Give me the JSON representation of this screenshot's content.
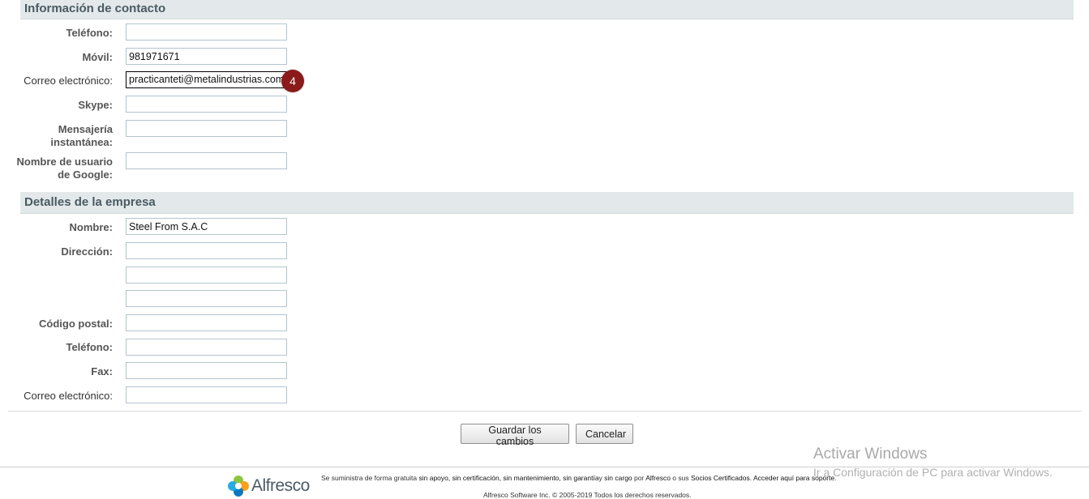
{
  "contact": {
    "title": "Información de contacto",
    "phone_label": "Teléfono:",
    "phone_value": "",
    "mobile_label": "Móvil:",
    "mobile_value": "981971671",
    "email_label": "Correo electrónico:",
    "email_value": "practicanteti@metalindustrias.com",
    "skype_label": "Skype:",
    "skype_value": "",
    "im_label_1": "Mensajería",
    "im_label_2": "instantánea:",
    "im_value": "",
    "google_label_1": "Nombre de usuario",
    "google_label_2": "de Google:",
    "google_value": ""
  },
  "badge": {
    "number": "4",
    "color": "#8b1a1a"
  },
  "company": {
    "title": "Detalles de la empresa",
    "name_label": "Nombre:",
    "name_value": "Steel From S.A.C",
    "address_label": "Dirección:",
    "address_1": "",
    "address_2": "",
    "address_3": "",
    "postal_label": "Código postal:",
    "postal_value": "",
    "phone_label": "Teléfono:",
    "phone_value": "",
    "fax_label": "Fax:",
    "fax_value": "",
    "email_label": "Correo electrónico:",
    "email_value": ""
  },
  "buttons": {
    "save": "Guardar los cambios",
    "cancel": "Cancelar"
  },
  "watermark": {
    "line1": "Activar Windows",
    "line2": "Ir a Configuración de PC para activar Windows."
  },
  "footer": {
    "logo_text": "Alfresco",
    "t1": "Se suministra de forma gratuita ",
    "t2": "sin apoyo, sin certificación, sin mantenimiento, sin garantía",
    "t3": "y ",
    "t4": "sin cargo",
    "t5": " por ",
    "t6": "Alfresco",
    "t7": " o sus ",
    "t8": "Socios Certificados",
    "t9": ". ",
    "t10": "Acceder aquí para soporte",
    "t11": ".",
    "copyright": "Alfresco Software Inc. © 2005-2019 Todos los derechos reservados."
  }
}
